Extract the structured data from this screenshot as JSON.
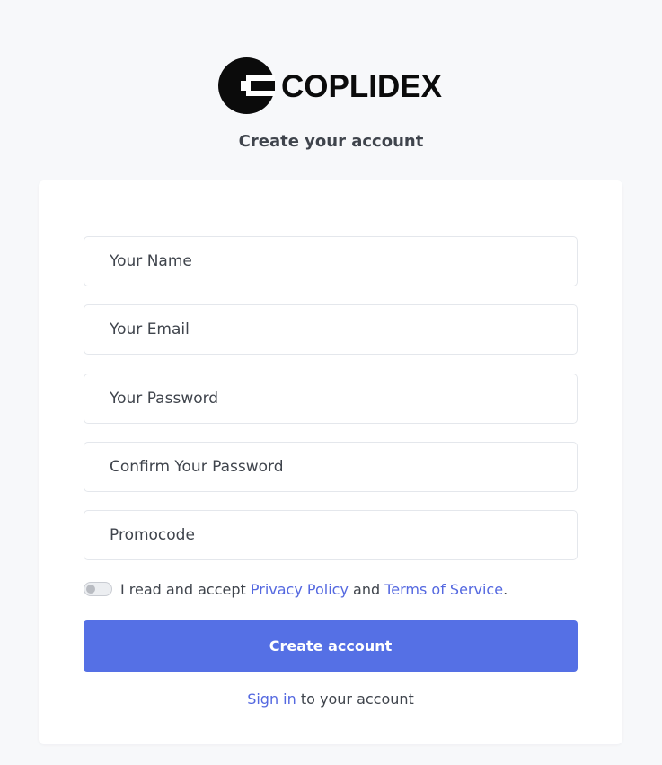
{
  "brand": {
    "name": "COPLIDEX",
    "logo_icon": "coplidex-c-logo-icon"
  },
  "page": {
    "subtitle": "Create your account"
  },
  "form": {
    "fields": {
      "name_placeholder": "Your Name",
      "email_placeholder": "Your Email",
      "password_placeholder": "Your Password",
      "confirm_password_placeholder": "Confirm Your Password",
      "promocode_placeholder": "Promocode"
    },
    "terms": {
      "toggle_on": false,
      "prefix": "I read and accept",
      "privacy_link": "Privacy Policy",
      "conjunction": "and",
      "terms_link": "Terms of Service",
      "suffix": "."
    },
    "submit_label": "Create account",
    "signin": {
      "link": "Sign in",
      "suffix": "to your account"
    }
  },
  "colors": {
    "background": "#f7f8fa",
    "card": "#ffffff",
    "primary_button": "#5570e5",
    "link": "#5468e0",
    "text": "#3f444c",
    "logo": "#0b0b0b"
  }
}
